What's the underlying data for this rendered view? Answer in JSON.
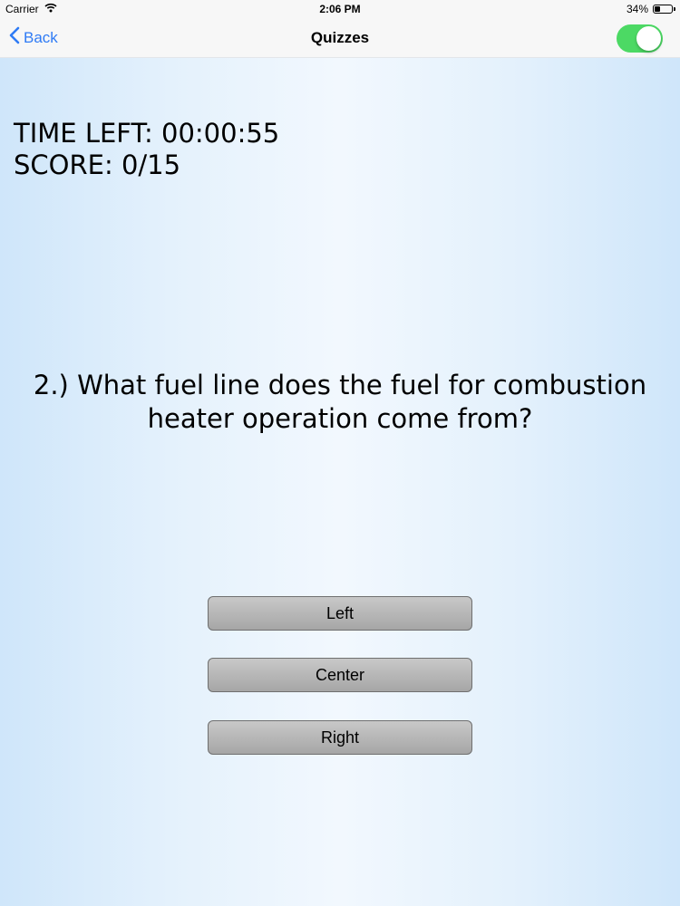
{
  "status_bar": {
    "carrier": "Carrier",
    "time": "2:06 PM",
    "battery_text": "34%",
    "battery_level": 0.34
  },
  "nav": {
    "back_label": "Back",
    "title": "Quizzes",
    "toggle_on": true
  },
  "quiz": {
    "time_left": "TIME LEFT: 00:00:55",
    "score": "SCORE: 0/15",
    "question": "2.) What fuel line does the fuel for combustion heater operation come from?",
    "answers": [
      "Left",
      "Center",
      "Right"
    ]
  },
  "colors": {
    "accent": "#2f7bf5",
    "toggle_on": "#4cd964"
  }
}
